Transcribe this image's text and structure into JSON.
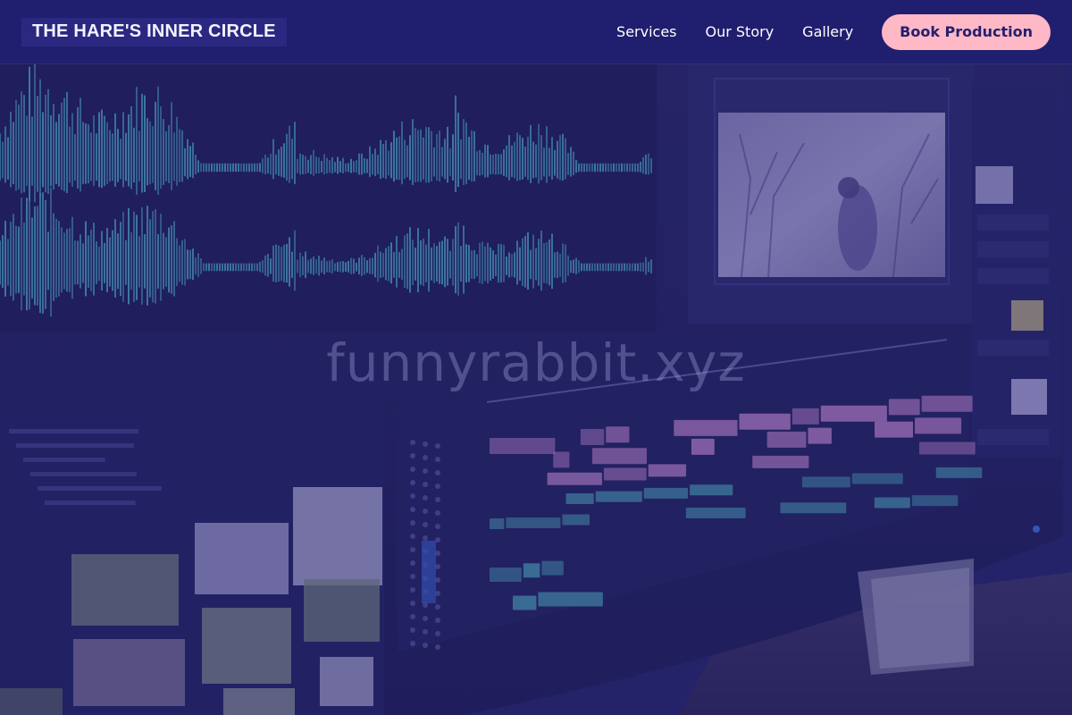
{
  "brand": {
    "name": "THE HARE'S INNER CIRCLE"
  },
  "nav": {
    "links": [
      {
        "label": "Services"
      },
      {
        "label": "Our Story"
      },
      {
        "label": "Gallery"
      }
    ],
    "cta_label": "Book Production"
  },
  "hero": {
    "watermark": "funnyrabbit.xyz",
    "scene": "video-editing-monitor"
  },
  "colors": {
    "nav_bg": "#201e6e",
    "cta_bg": "#ffb8c6",
    "cta_text": "#231f6e",
    "waveform": "#4fb3c4",
    "timeline_pink": "#c98ac9",
    "timeline_teal": "#4aa7b0"
  }
}
